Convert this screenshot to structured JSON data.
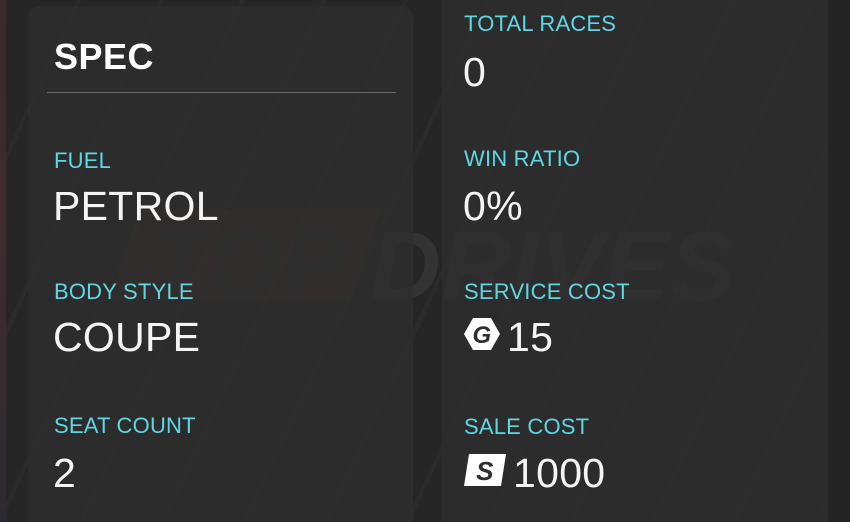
{
  "spec": {
    "title": "SPEC",
    "fuel": {
      "label": "FUEL",
      "value": "PETROL"
    },
    "body_style": {
      "label": "BODY STYLE",
      "value": "COUPE"
    },
    "seat_count": {
      "label": "SEAT COUNT",
      "value": "2"
    }
  },
  "stats": {
    "total_races": {
      "label": "TOTAL RACES",
      "value": "0"
    },
    "win_ratio": {
      "label": "WIN RATIO",
      "value": "0%"
    },
    "service_cost": {
      "label": "SERVICE COST",
      "value": "15",
      "icon": "gold-coin-g-icon"
    },
    "sale_cost": {
      "label": "SALE COST",
      "value": "1000",
      "icon": "cash-s-icon"
    }
  },
  "watermark": {
    "text_top": "TOP",
    "text_drives": "DRIVES"
  },
  "colors": {
    "label": "#5fd6e3",
    "value": "#f4f4f4",
    "watermark_accent": "#5a3520"
  }
}
